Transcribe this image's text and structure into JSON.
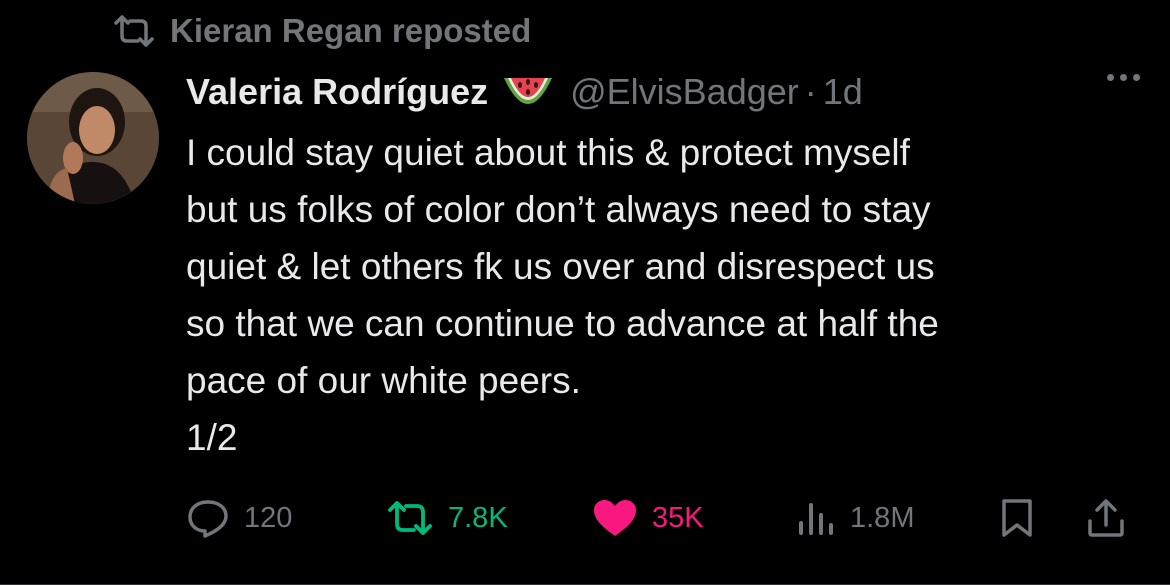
{
  "repost": {
    "icon": "repost-icon",
    "text": "Kieran Regan reposted"
  },
  "author": {
    "name": "Valeria Rodríguez",
    "emoji": "watermelon-emoji",
    "handle": "@ElvisBadger",
    "separator": "·",
    "time": "1d"
  },
  "tweet": {
    "lines": [
      "I could stay quiet about this & protect myself",
      "but us folks of color don’t always need to stay",
      "quiet & let others fk us over and disrespect us",
      "so that we can continue to advance at half the",
      "pace of our white peers.",
      "1/2"
    ]
  },
  "actions": {
    "replies": "120",
    "reposts": "7.8K",
    "likes": "35K",
    "views": "1.8M"
  },
  "colors": {
    "background": "#000000",
    "text": "#e7e9ea",
    "muted": "#71767b",
    "repost_green": "#00ba7c",
    "like_pink": "#f91880"
  }
}
